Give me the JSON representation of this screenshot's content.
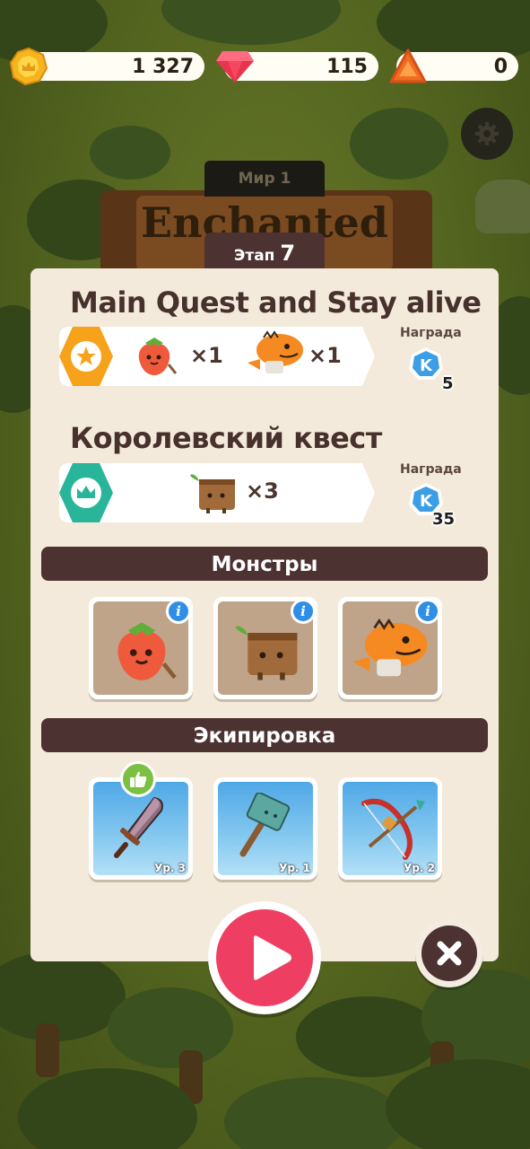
{
  "currencies": {
    "coins": {
      "value": "1 327",
      "icon": "gold-coin-icon"
    },
    "gems": {
      "value": "115",
      "icon": "red-gem-icon"
    },
    "triangles": {
      "value": "0",
      "icon": "orange-triangle-icon"
    }
  },
  "background": {
    "world_label": "Мир 1",
    "banner_text": "Enchanted"
  },
  "stage": {
    "label": "Этап",
    "number": "7"
  },
  "quests": [
    {
      "title": "Main Quest and Stay alive",
      "badge_icon": "star-icon",
      "badge_color": "#f6a21a",
      "objectives": [
        {
          "icon": "strawberry-monster-icon",
          "count": "×1"
        },
        {
          "icon": "orange-dino-monster-icon",
          "count": "×1"
        }
      ],
      "reward_label": "Награда",
      "reward_icon": "k-token-icon",
      "reward_amount": "5"
    },
    {
      "title": "Королевский квест",
      "badge_icon": "crown-icon",
      "badge_color": "#29b59a",
      "objectives": [
        {
          "icon": "wood-stump-monster-icon",
          "count": "×3"
        }
      ],
      "reward_label": "Награда",
      "reward_icon": "k-token-icon",
      "reward_amount": "35"
    }
  ],
  "monsters": {
    "header": "Монстры",
    "items": [
      {
        "icon": "strawberry-monster-icon",
        "info": "i"
      },
      {
        "icon": "wood-stump-monster-icon",
        "info": "i"
      },
      {
        "icon": "orange-dino-monster-icon",
        "info": "i"
      }
    ]
  },
  "equipment": {
    "header": "Экипировка",
    "items": [
      {
        "icon": "sword-icon",
        "level": "Ур. 3",
        "recommended": true
      },
      {
        "icon": "hammer-icon",
        "level": "Ур. 1"
      },
      {
        "icon": "bow-icon",
        "level": "Ур. 2"
      }
    ]
  },
  "colors": {
    "panel": "#f3eadb",
    "header": "#4d3232",
    "play": "#ee3f62"
  }
}
